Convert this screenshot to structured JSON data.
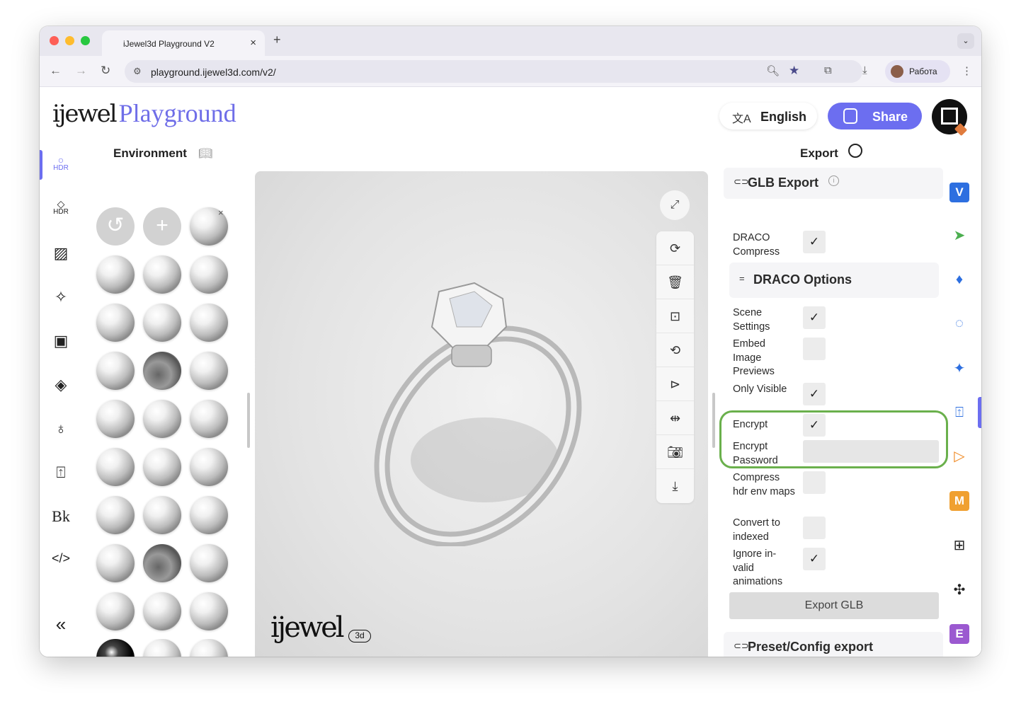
{
  "browser": {
    "tab_title": "iJewel3d Playground V2",
    "tab_close": "×",
    "new_tab": "+",
    "url": "playground.ijewel3d.com/v2/",
    "profile_name": "Работа"
  },
  "header": {
    "logo_brand": "ijewel",
    "logo_product": "Playground",
    "language_label": "English",
    "share_label": "Share"
  },
  "left_rail": {
    "items": [
      {
        "icon": "hdr-icon",
        "label": "HDR"
      },
      {
        "icon": "hdr-diamond-icon",
        "label": "HDR"
      },
      {
        "icon": "stripes-icon",
        "label": ""
      },
      {
        "icon": "sparkles-icon",
        "label": ""
      },
      {
        "icon": "image-icon",
        "label": ""
      },
      {
        "icon": "plane-icon",
        "label": ""
      },
      {
        "icon": "ring-icon",
        "label": ""
      },
      {
        "icon": "export-icon",
        "label": ""
      },
      {
        "icon": "bk-beta-icon",
        "label": ""
      },
      {
        "icon": "code-icon",
        "label": ""
      }
    ],
    "collapse_label": "«"
  },
  "environment": {
    "title": "Environment"
  },
  "viewport": {
    "logo": "ijewel",
    "logo_badge": "3d"
  },
  "export_panel": {
    "title": "Export",
    "glb_export_label": "GLB Export",
    "info_glyph": "i",
    "draco_compress_label": "DRACO Compress",
    "draco_options_label": "DRACO Options",
    "options": [
      {
        "label": "Scene Settings",
        "checked": true
      },
      {
        "label": "Embed Image Previews",
        "checked": false
      },
      {
        "label": "Only Visible",
        "checked": true
      },
      {
        "label": "Encrypt",
        "checked": true
      },
      {
        "label": "Encrypt Password",
        "checked": false
      },
      {
        "label": "Compress hdr env maps",
        "checked": false
      },
      {
        "label": "Convert to indexed",
        "checked": false
      },
      {
        "label": "Ignore in-valid animations",
        "checked": true
      }
    ],
    "export_button": "Export GLB",
    "preset_export_label": "Preset/Config export",
    "check_glyph": "✓"
  },
  "right_rail": {
    "items": [
      {
        "icon": "v-badge-icon",
        "text": "V",
        "color": "#2d6fe0"
      },
      {
        "icon": "cursor-icon",
        "text": "",
        "color": "#4caf50"
      },
      {
        "icon": "shapes-icon",
        "text": "",
        "color": "#2d6fe0"
      },
      {
        "icon": "loader-icon",
        "text": "",
        "color": "#2d6fe0"
      },
      {
        "icon": "star-icon",
        "text": "",
        "color": "#2d6fe0"
      },
      {
        "icon": "export-icon",
        "text": "",
        "color": "#2d6fe0"
      },
      {
        "icon": "play-icon",
        "text": "",
        "color": "#f08a24"
      },
      {
        "icon": "m-badge-icon",
        "text": "M",
        "color": "#f0a030"
      },
      {
        "icon": "grid-icon",
        "text": "",
        "color": "#222222"
      },
      {
        "icon": "puzzle-icon",
        "text": "",
        "color": "#222222"
      },
      {
        "icon": "e-badge-icon",
        "text": "E",
        "color": "#9b59d0"
      }
    ]
  },
  "colors": {
    "accent": "#6c6ef0",
    "highlight": "#6ab04c"
  }
}
